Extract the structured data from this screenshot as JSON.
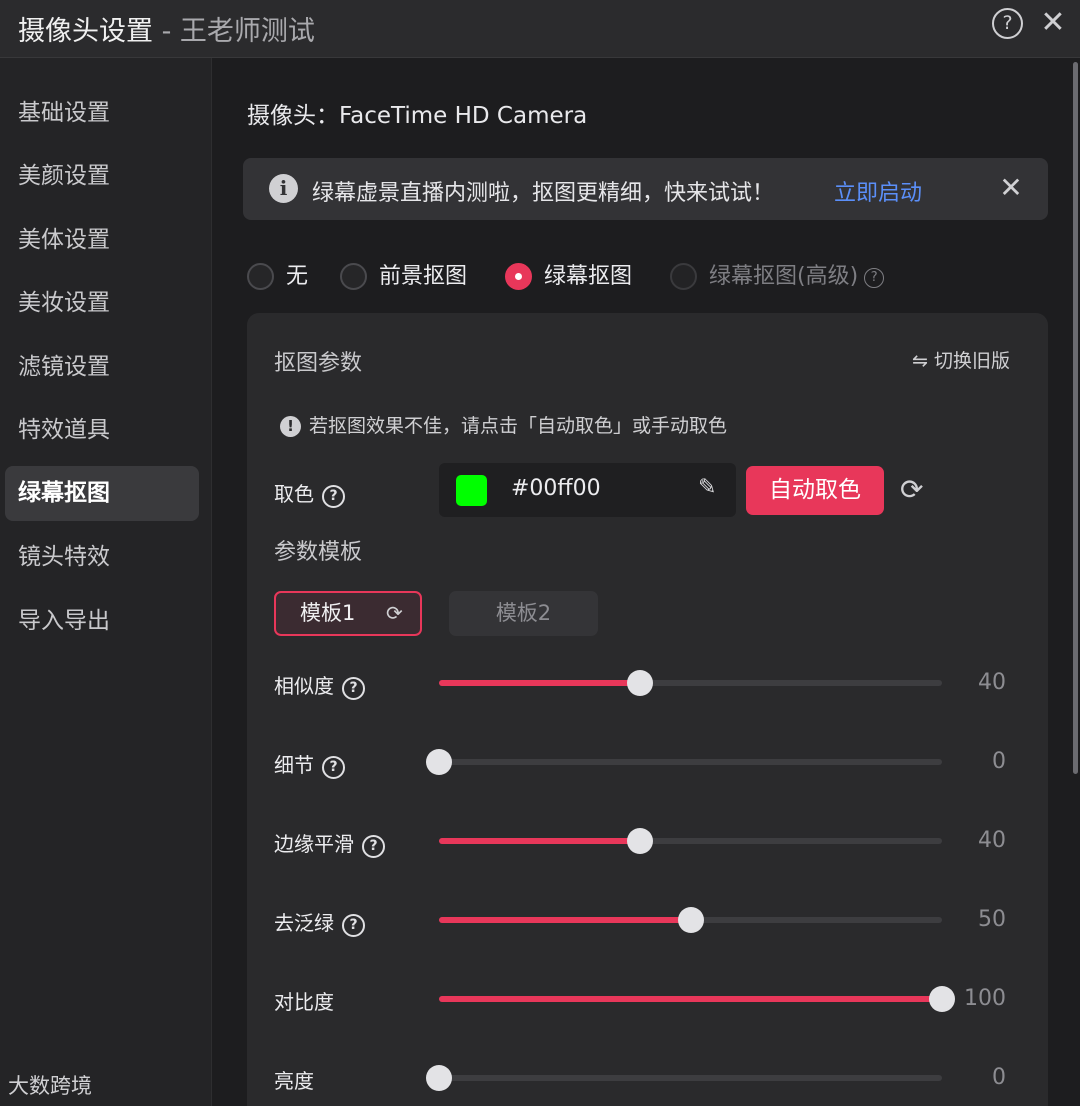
{
  "window": {
    "title": "摄像头设置",
    "title_separator": " - ",
    "title_sub": "王老师测试"
  },
  "sidebar": {
    "items": [
      {
        "label": "基础设置"
      },
      {
        "label": "美颜设置"
      },
      {
        "label": "美体设置"
      },
      {
        "label": "美妆设置"
      },
      {
        "label": "滤镜设置"
      },
      {
        "label": "特效道具"
      },
      {
        "label": "绿幕抠图",
        "active": true
      },
      {
        "label": "镜头特效"
      },
      {
        "label": "导入导出"
      }
    ]
  },
  "camera_label": "摄像头：FaceTime HD Camera",
  "notice": {
    "text": "绿幕虚景直播内测啦，抠图更精细，快来试试！",
    "link": "立即启动"
  },
  "matting_modes": [
    {
      "label": "无",
      "selected": false
    },
    {
      "label": "前景抠图",
      "selected": false
    },
    {
      "label": "绿幕抠图",
      "selected": true
    },
    {
      "label": "绿幕抠图(高级)",
      "selected": false,
      "disabled": true
    }
  ],
  "params": {
    "title": "抠图参数",
    "switch_old": "⇋ 切换旧版",
    "tip": "若抠图效果不佳，请点击「自动取色」或手动取色",
    "color_label": "取色",
    "color_value": "#00ff00",
    "swatch_color": "#00ff00",
    "auto_pick": "自动取色",
    "template_label": "参数模板",
    "templates": [
      {
        "label": "模板1",
        "active": true
      },
      {
        "label": "模板2",
        "active": false
      }
    ]
  },
  "sliders": [
    {
      "label": "相似度",
      "value": 40,
      "help": true
    },
    {
      "label": "细节",
      "value": 0,
      "help": true
    },
    {
      "label": "边缘平滑",
      "value": 40,
      "help": true
    },
    {
      "label": "去泛绿",
      "value": 50,
      "help": true
    },
    {
      "label": "对比度",
      "value": 100,
      "help": false
    },
    {
      "label": "亮度",
      "value": 0,
      "help": false
    }
  ],
  "slider_max": 100,
  "accent_color": "#e8375a",
  "watermark": "大数跨境"
}
